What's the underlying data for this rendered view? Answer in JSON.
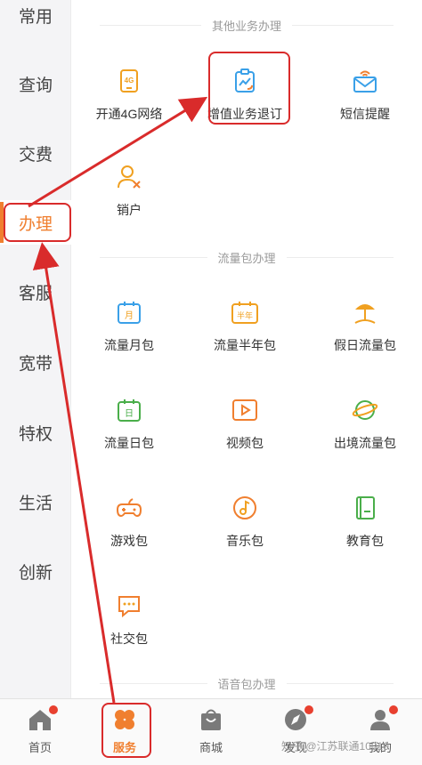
{
  "sidebar": {
    "items": [
      {
        "label": "常用"
      },
      {
        "label": "查询"
      },
      {
        "label": "交费"
      },
      {
        "label": "办理"
      },
      {
        "label": "客服"
      },
      {
        "label": "宽带"
      },
      {
        "label": "特权"
      },
      {
        "label": "生活"
      },
      {
        "label": "创新"
      }
    ],
    "active_index": 3
  },
  "sections": {
    "other": {
      "title": "其他业务办理",
      "items": [
        {
          "label": "开通4G网络",
          "icon": "4g-icon"
        },
        {
          "label": "增值业务退订",
          "icon": "value-added-unsubscribe-icon"
        },
        {
          "label": "短信提醒",
          "icon": "sms-reminder-icon"
        },
        {
          "label": "销户",
          "icon": "close-account-icon"
        }
      ],
      "icon_text_4g": "4G"
    },
    "data": {
      "title": "流量包办理",
      "items": [
        {
          "label": "流量月包",
          "icon": "monthly-data-icon",
          "badge": "月"
        },
        {
          "label": "流量半年包",
          "icon": "half-year-data-icon",
          "badge": "半年"
        },
        {
          "label": "假日流量包",
          "icon": "holiday-data-icon"
        },
        {
          "label": "流量日包",
          "icon": "daily-data-icon",
          "badge": "日"
        },
        {
          "label": "视频包",
          "icon": "video-icon"
        },
        {
          "label": "出境流量包",
          "icon": "roaming-data-icon"
        },
        {
          "label": "游戏包",
          "icon": "game-icon"
        },
        {
          "label": "音乐包",
          "icon": "music-icon"
        },
        {
          "label": "教育包",
          "icon": "education-icon"
        },
        {
          "label": "社交包",
          "icon": "social-icon"
        }
      ]
    },
    "voice": {
      "title": "语音包办理"
    }
  },
  "tabbar": {
    "items": [
      {
        "label": "首页",
        "icon": "home-icon"
      },
      {
        "label": "服务",
        "icon": "service-icon"
      },
      {
        "label": "商城",
        "icon": "mall-icon"
      },
      {
        "label": "发现",
        "icon": "discover-icon"
      },
      {
        "label": "我的",
        "icon": "profile-icon"
      }
    ],
    "active_index": 1
  },
  "watermark": "知乎 @江苏联通10010",
  "colors": {
    "accent": "#f07f2f",
    "annotation": "#d92b2b",
    "badge_dot": "#e8402f",
    "icon_blue": "#3aa0e8",
    "icon_green": "#4aae4a",
    "icon_orange": "#f0a020"
  }
}
